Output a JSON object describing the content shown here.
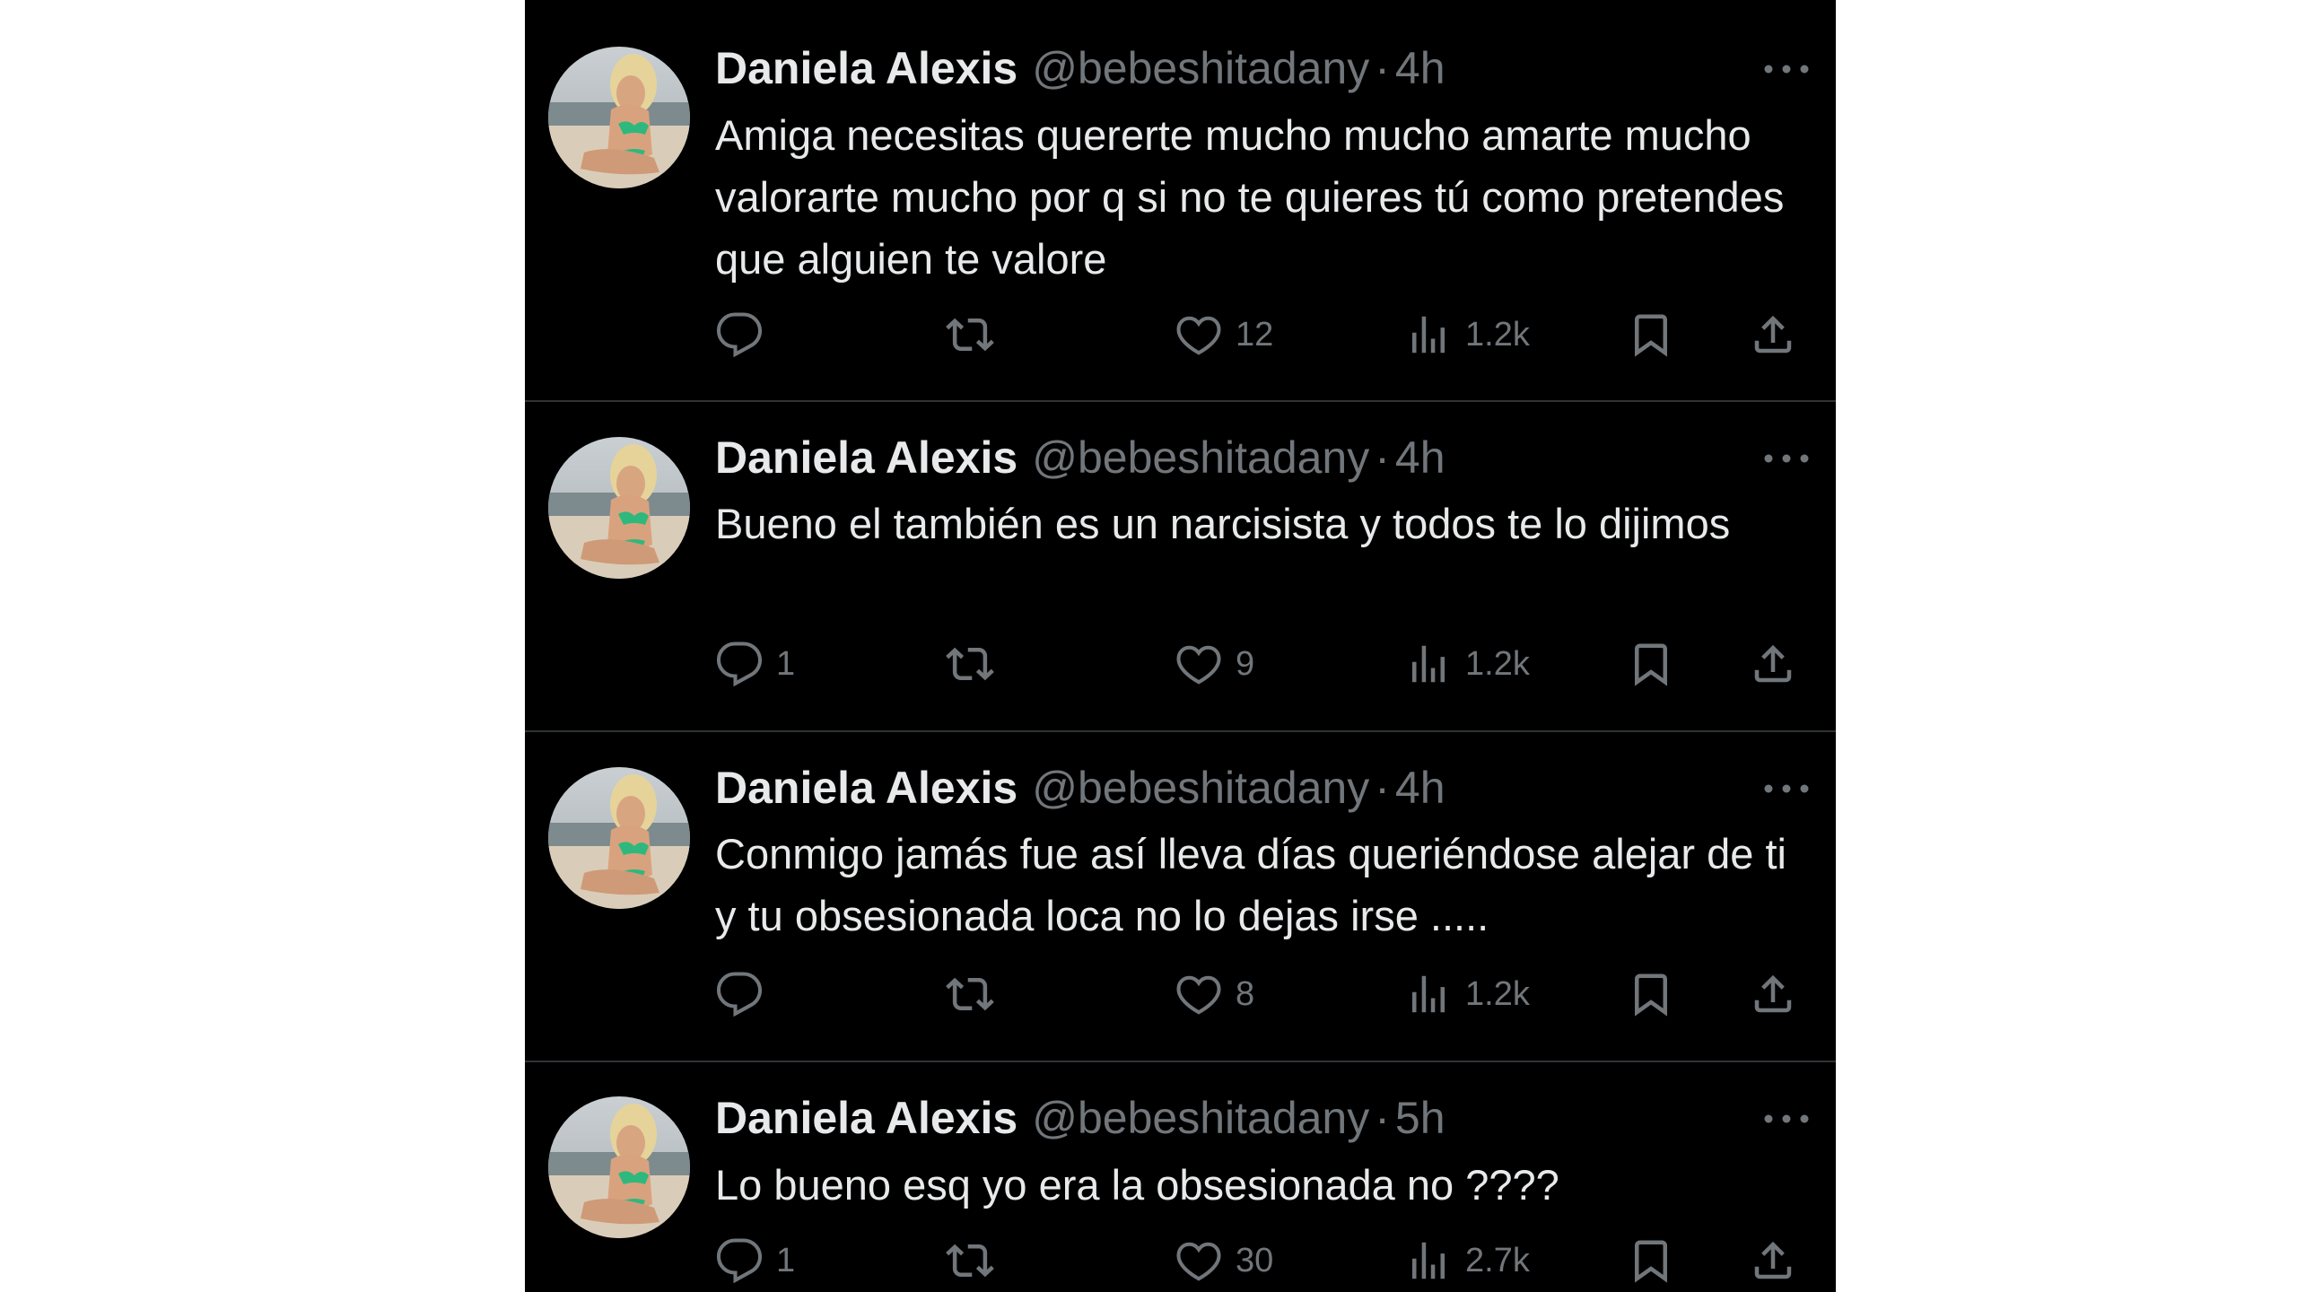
{
  "tweets": [
    {
      "name": "Daniela Alexis",
      "handle": "@bebeshitadany",
      "separator": "·",
      "time": "4h",
      "text": "Amiga necesitas quererte mucho mucho amarte mucho valorarte mucho por q si no te quieres tú como pretendes que alguien te valore",
      "replies": "",
      "reposts": "",
      "likes": "12",
      "views": "1.2k"
    },
    {
      "name": "Daniela Alexis",
      "handle": "@bebeshitadany",
      "separator": "·",
      "time": "4h",
      "text": "Bueno el también es un narcisista y todos te lo dijimos",
      "replies": "1",
      "reposts": "",
      "likes": "9",
      "views": "1.2k"
    },
    {
      "name": "Daniela Alexis",
      "handle": "@bebeshitadany",
      "separator": "·",
      "time": "4h",
      "text": "Conmigo jamás fue así lleva días queriéndose alejar de ti y tu obsesionada loca no lo dejas irse .....",
      "replies": "",
      "reposts": "",
      "likes": "8",
      "views": "1.2k"
    },
    {
      "name": "Daniela Alexis",
      "handle": "@bebeshitadany",
      "separator": "·",
      "time": "5h",
      "text": "Lo bueno esq yo era la obsesionada no ????",
      "replies": "1",
      "reposts": "",
      "likes": "30",
      "views": "2.7k"
    }
  ],
  "icons": {
    "reply": "reply-icon",
    "repost": "repost-icon",
    "like": "heart-icon",
    "views": "views-icon",
    "bookmark": "bookmark-icon",
    "share": "share-icon",
    "more": "more-icon"
  },
  "colors": {
    "background": "#000000",
    "primary_text": "#e7e9ea",
    "secondary_text": "#71767b",
    "divider": "#2f3336"
  }
}
